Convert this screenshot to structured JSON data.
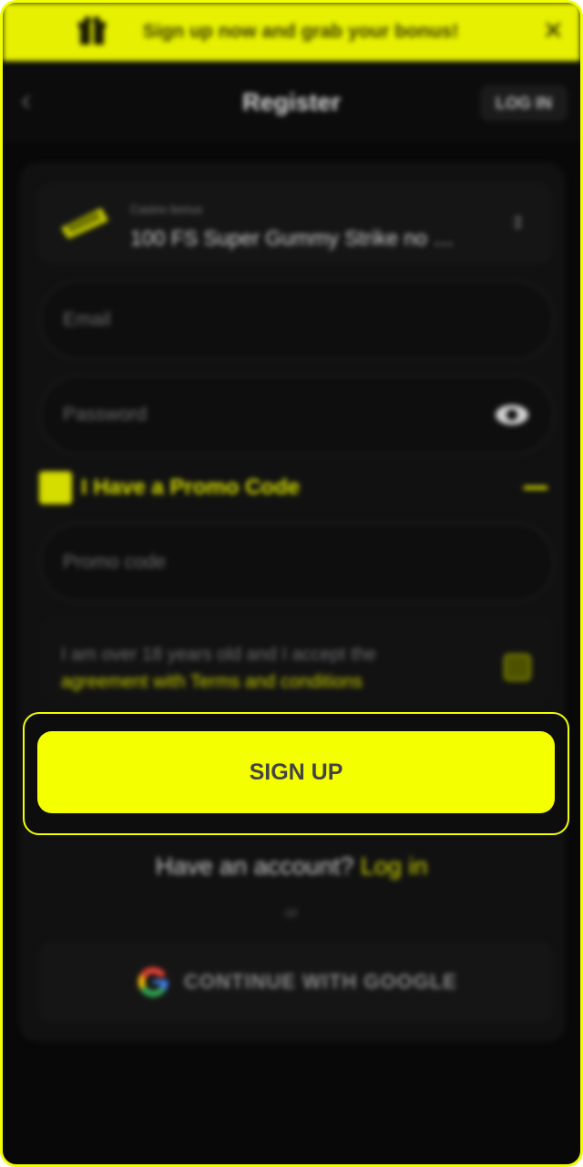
{
  "banner": {
    "text": "Sign up now and grab your bonus!",
    "close": "✕"
  },
  "header": {
    "back": "‹",
    "title": "Register",
    "login_button": "LOG IN"
  },
  "bonus": {
    "label": "Casino bonus",
    "value": "100 FS Super Gummy Strike no …",
    "chevron": "⇕"
  },
  "form": {
    "email_placeholder": "Email",
    "password_placeholder": "Password",
    "promo_label": "I Have a Promo Code",
    "promo_placeholder": "Promo code",
    "terms_text": "I am over 18 years old and I accept the",
    "terms_link": "agreement with Terms and conditions",
    "signup_label": "SIGN UP"
  },
  "footer": {
    "have_account": "Have an account?",
    "login_link": "Log in",
    "or": "or",
    "google_label": "CONTINUE WITH GOOGLE"
  },
  "colors": {
    "accent": "#f4ff00",
    "background": "#080808"
  },
  "icons": [
    "gift-icon",
    "close-icon",
    "back-icon",
    "bonus-icon",
    "chevron-updown-icon",
    "eye-icon",
    "google-icon"
  ]
}
